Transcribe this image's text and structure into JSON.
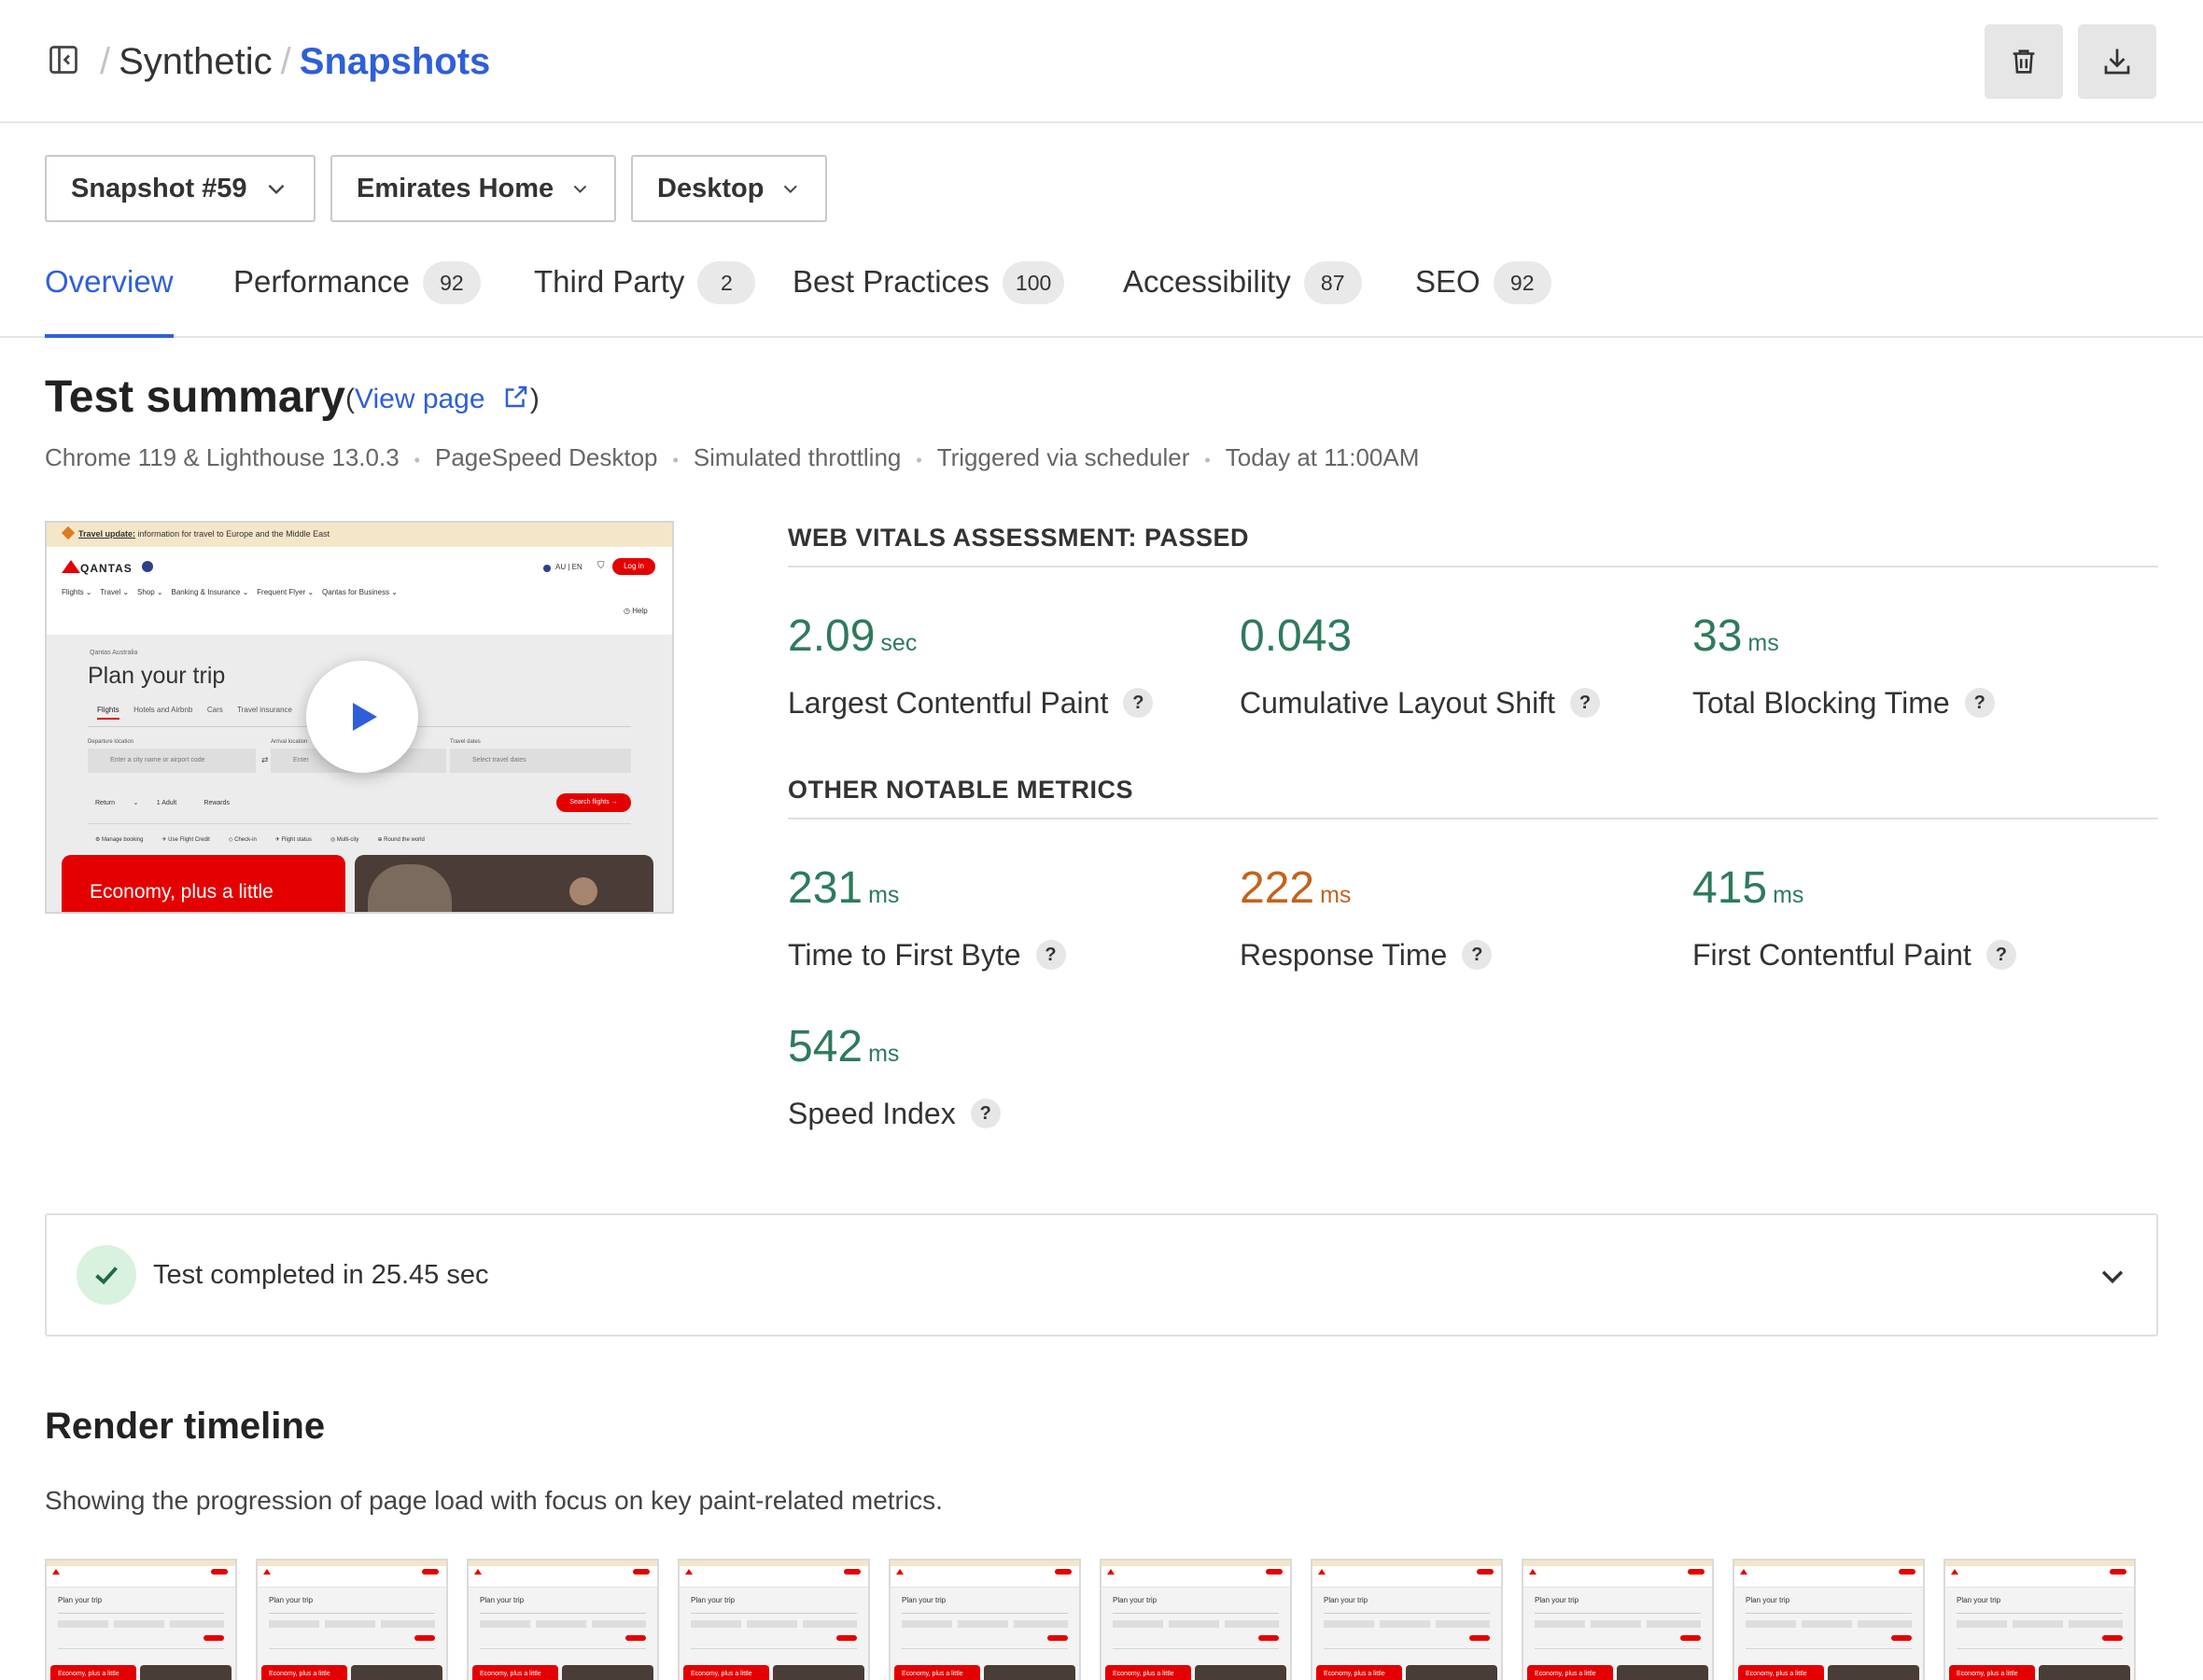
{
  "breadcrumb": {
    "root": "Synthetic",
    "current": "Snapshots"
  },
  "filters": {
    "snapshot": "Snapshot #59",
    "page": "Emirates Home",
    "device": "Desktop"
  },
  "tabs": [
    {
      "label": "Overview",
      "badge": ""
    },
    {
      "label": "Performance",
      "badge": "92"
    },
    {
      "label": "Third Party",
      "badge": "2"
    },
    {
      "label": "Best Practices",
      "badge": "100"
    },
    {
      "label": "Accessibility",
      "badge": "87"
    },
    {
      "label": "SEO",
      "badge": "92"
    }
  ],
  "summary": {
    "title": "Test summary",
    "view_page_open": "(",
    "view_page": "View page",
    "view_page_close": ")",
    "meta": [
      "Chrome 119 & Lighthouse 13.0.3",
      "PageSpeed Desktop",
      "Simulated throttling",
      "Triggered via scheduler",
      "Today at 11:00AM"
    ]
  },
  "screenshot": {
    "banner_link": "Travel update:",
    "banner_text": "information for travel to Europe and the Middle East",
    "logo": "QANTAS",
    "locale": "AU | EN",
    "login": "Log in",
    "nav": [
      "Flights",
      "Travel",
      "Shop",
      "Banking & Insurance",
      "Frequent Flyer",
      "Qantas for Business"
    ],
    "help": "Help",
    "kicker": "Qantas Australia",
    "heading": "Plan your trip",
    "search_tabs": [
      "Flights",
      "Hotels and Airbnb",
      "Cars",
      "Travel insurance"
    ],
    "departure_label": "Departure location",
    "departure_placeholder": "Enter a city name or airport code",
    "arrival_label": "Arrival location",
    "arrival_placeholder": "Enter",
    "dates_label": "Travel dates",
    "dates_placeholder": "Select travel dates",
    "trip_type": "Return",
    "passengers": "1 Adult",
    "rewards": "Rewards",
    "search_button": "Search flights",
    "quick_links": [
      "Manage booking",
      "Use Flight Credit",
      "Check-in",
      "Flight status",
      "Multi-city",
      "Round the world"
    ],
    "promo": "Economy, plus a little"
  },
  "web_vitals": {
    "heading": "WEB VITALS ASSESSMENT: PASSED",
    "metrics": [
      {
        "value": "2.09",
        "unit": "sec",
        "name": "Largest Contentful Paint",
        "status": "good"
      },
      {
        "value": "0.043",
        "unit": "",
        "name": "Cumulative Layout Shift",
        "status": "good"
      },
      {
        "value": "33",
        "unit": "ms",
        "name": "Total Blocking Time",
        "status": "good"
      }
    ]
  },
  "other_metrics": {
    "heading": "OTHER NOTABLE METRICS",
    "metrics": [
      {
        "value": "231",
        "unit": "ms",
        "name": "Time to First Byte",
        "status": "good"
      },
      {
        "value": "222",
        "unit": "ms",
        "name": "Response Time",
        "status": "needs-improvement"
      },
      {
        "value": "415",
        "unit": "ms",
        "name": "First Contentful Paint",
        "status": "good"
      },
      {
        "value": "542",
        "unit": "ms",
        "name": "Speed Index",
        "status": "good"
      }
    ]
  },
  "help_mark": "?",
  "completion": {
    "text": "Test completed in 25.45 sec"
  },
  "render_timeline": {
    "title": "Render timeline",
    "subtitle": "Showing the progression of page load with focus on key paint-related metrics.",
    "frame_heading": "Plan your trip",
    "frame_promo": "Economy, plus a little",
    "frame_count": 10
  },
  "colors": {
    "accent": "#2f5fd8",
    "good": "#2e7a5c",
    "warn": "#c4621c",
    "brand_red": "#e40000"
  }
}
